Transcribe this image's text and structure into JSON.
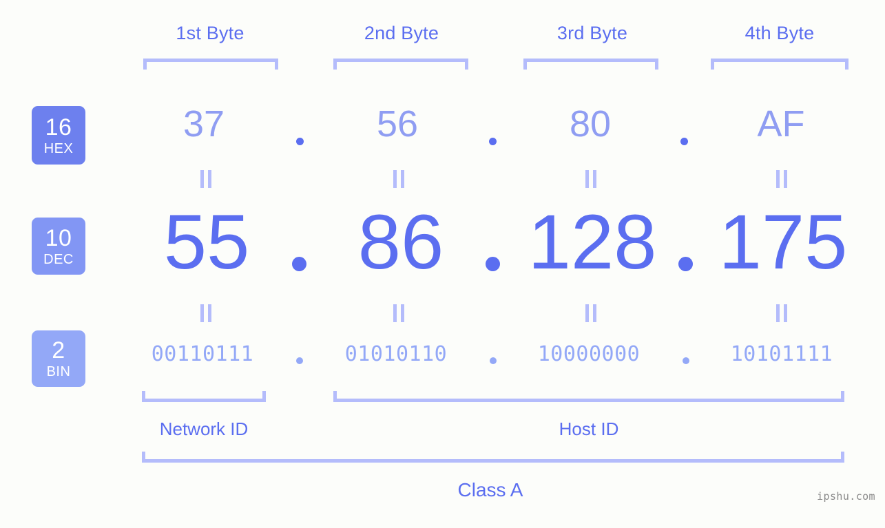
{
  "background_color": "#fcfdfa",
  "accent_color": "#5b6ef0",
  "bracket_color": "#b4bcfb",
  "byte_headers": [
    {
      "label": "1st Byte"
    },
    {
      "label": "2nd Byte"
    },
    {
      "label": "3rd Byte"
    },
    {
      "label": "4th Byte"
    }
  ],
  "rows": {
    "hex": {
      "badge_number": "16",
      "badge_abbr": "HEX",
      "badge_color": "#6d80ee",
      "text_color": "#8f9df2",
      "values": [
        "37",
        "56",
        "80",
        "AF"
      ],
      "separator": "."
    },
    "dec": {
      "badge_number": "10",
      "badge_abbr": "DEC",
      "badge_color": "#8296f4",
      "text_color": "#5b6ef0",
      "values": [
        "55",
        "86",
        "128",
        "175"
      ],
      "separator": "."
    },
    "bin": {
      "badge_number": "2",
      "badge_abbr": "BIN",
      "badge_color": "#93a8f7",
      "text_color": "#93a8f7",
      "values": [
        "00110111",
        "01010110",
        "10000000",
        "10101111"
      ],
      "separator": "."
    }
  },
  "equals_symbol": "=",
  "segments": {
    "network_id": "Network ID",
    "host_id": "Host ID",
    "class": "Class A"
  },
  "watermark": "ipshu.com"
}
